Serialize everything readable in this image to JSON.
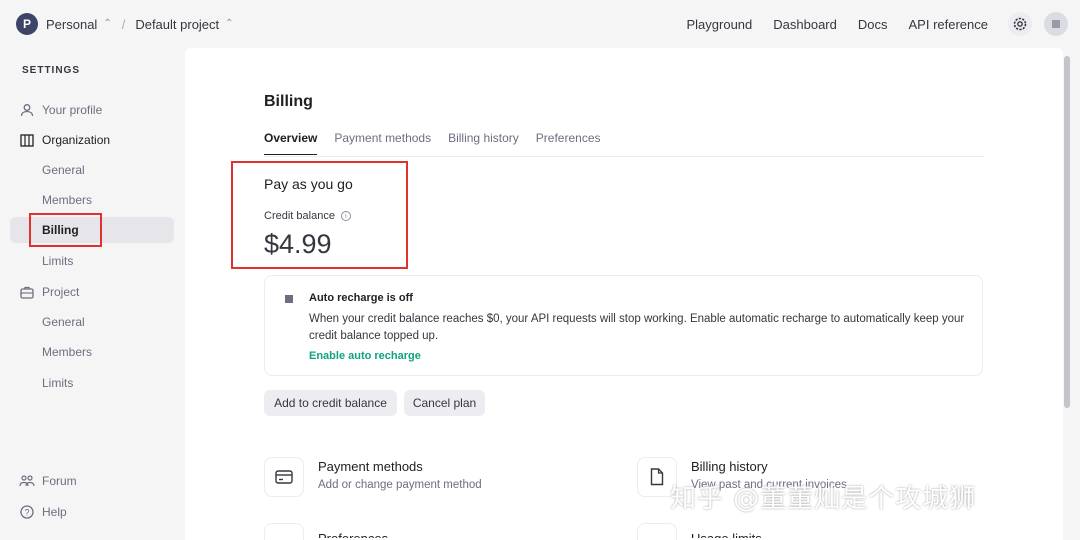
{
  "topbar": {
    "org_initial": "P",
    "org_name": "Personal",
    "project_name": "Default project",
    "separator": "/",
    "nav": [
      "Playground",
      "Dashboard",
      "Docs",
      "API reference"
    ]
  },
  "sidebar": {
    "heading": "SETTINGS",
    "items": [
      {
        "label": "Your profile",
        "icon": "user-icon"
      },
      {
        "label": "Organization",
        "icon": "building-icon"
      },
      {
        "label": "General"
      },
      {
        "label": "Members"
      },
      {
        "label": "Billing",
        "active": true
      },
      {
        "label": "Limits"
      },
      {
        "label": "Project",
        "icon": "briefcase-icon"
      },
      {
        "label": "General"
      },
      {
        "label": "Members"
      },
      {
        "label": "Limits"
      }
    ],
    "footer": [
      {
        "label": "Forum",
        "icon": "people-icon"
      },
      {
        "label": "Help",
        "icon": "help-circle-icon"
      }
    ]
  },
  "billing": {
    "title": "Billing",
    "tabs": [
      "Overview",
      "Payment methods",
      "Billing history",
      "Preferences"
    ],
    "plan": "Pay as you go",
    "credit_label": "Credit balance",
    "credit_amount": "$4.99",
    "auto_recharge": {
      "title": "Auto recharge is off",
      "body": "When your credit balance reaches $0, your API requests will stop working. Enable automatic recharge to automatically keep your credit balance topped up.",
      "link": "Enable auto recharge"
    },
    "buttons": {
      "add_credit": "Add to credit balance",
      "cancel": "Cancel plan"
    },
    "features": [
      {
        "title": "Payment methods",
        "subtitle": "Add or change payment method",
        "icon": "credit-card-icon"
      },
      {
        "title": "Billing history",
        "subtitle": "View past and current invoices",
        "icon": "document-icon"
      }
    ],
    "peek": [
      "Preferences",
      "Usage limits"
    ]
  },
  "watermark": "知乎 @董董灿是个攻城狮",
  "colors": {
    "accent_green": "#10a37f",
    "highlight_red": "#e03131",
    "active_bg": "#e6e6ea"
  }
}
